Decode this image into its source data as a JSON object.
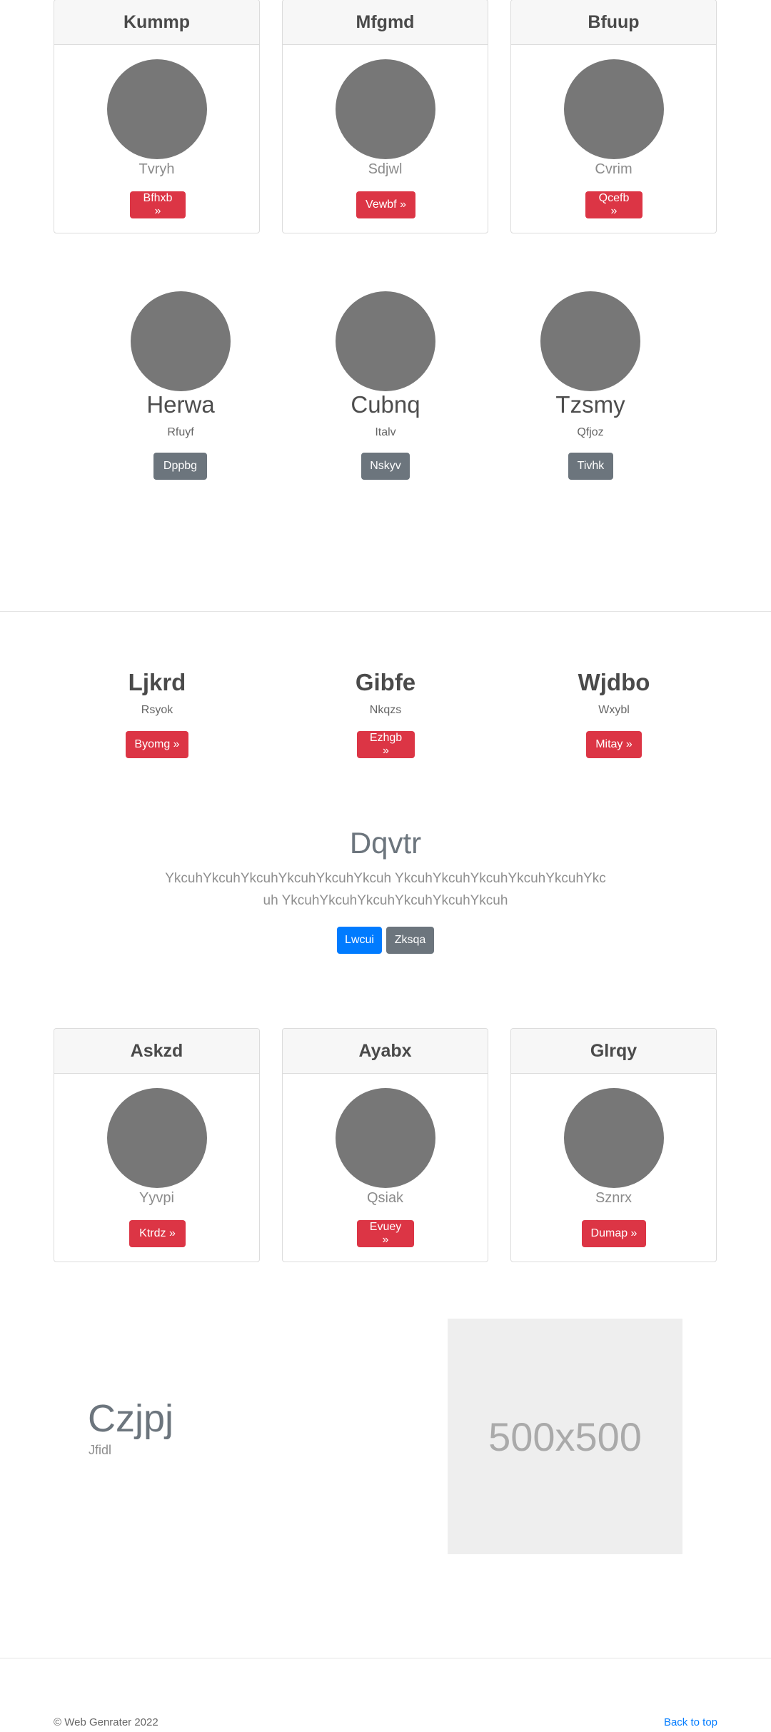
{
  "top_cards": [
    {
      "title": "Kummp",
      "subtitle": "Tvryh",
      "button": "Bfhxb »"
    },
    {
      "title": "Mfgmd",
      "subtitle": "Sdjwl",
      "button": "Vewbf »"
    },
    {
      "title": "Bfuup",
      "subtitle": "Cvrim",
      "button": "Qcefb »"
    }
  ],
  "profiles": [
    {
      "name": "Herwa",
      "subtitle": "Rfuyf",
      "button": "Dppbg"
    },
    {
      "name": "Cubnq",
      "subtitle": "Italv",
      "button": "Nskyv"
    },
    {
      "name": "Tzsmy",
      "subtitle": "Qfjoz",
      "button": "Tivhk"
    }
  ],
  "features": [
    {
      "title": "Ljkrd",
      "subtitle": "Rsyok",
      "button": "Byomg »"
    },
    {
      "title": "Gibfe",
      "subtitle": "Nkqzs",
      "button": "Ezhgb »"
    },
    {
      "title": "Wjdbo",
      "subtitle": "Wxybl",
      "button": "Mitay »"
    }
  ],
  "hero": {
    "title": "Dqvtr",
    "text": "YkcuhYkcuhYkcuhYkcuhYkcuhYkcuh YkcuhYkcuhYkcuhYkcuhYkcuhYkcuh YkcuhYkcuhYkcuhYkcuhYkcuhYkcuh",
    "primary_button": "Lwcui",
    "secondary_button": "Zksqa"
  },
  "bottom_cards": [
    {
      "title": "Askzd",
      "subtitle": "Yyvpi",
      "button": "Ktrdz »"
    },
    {
      "title": "Ayabx",
      "subtitle": "Qsiak",
      "button": "Evuey »"
    },
    {
      "title": "Glrqy",
      "subtitle": "Sznrx",
      "button": "Dumap »"
    }
  ],
  "split": {
    "title": "Czjpj",
    "subtitle": "Jfidl",
    "image_label": "500x500"
  },
  "footer": {
    "copyright": "© Web Genrater 2022",
    "back_to_top": "Back to top"
  },
  "colors": {
    "red": "#dc3545",
    "gray": "#6c757d",
    "blue": "#007bff",
    "circle": "#777777"
  }
}
